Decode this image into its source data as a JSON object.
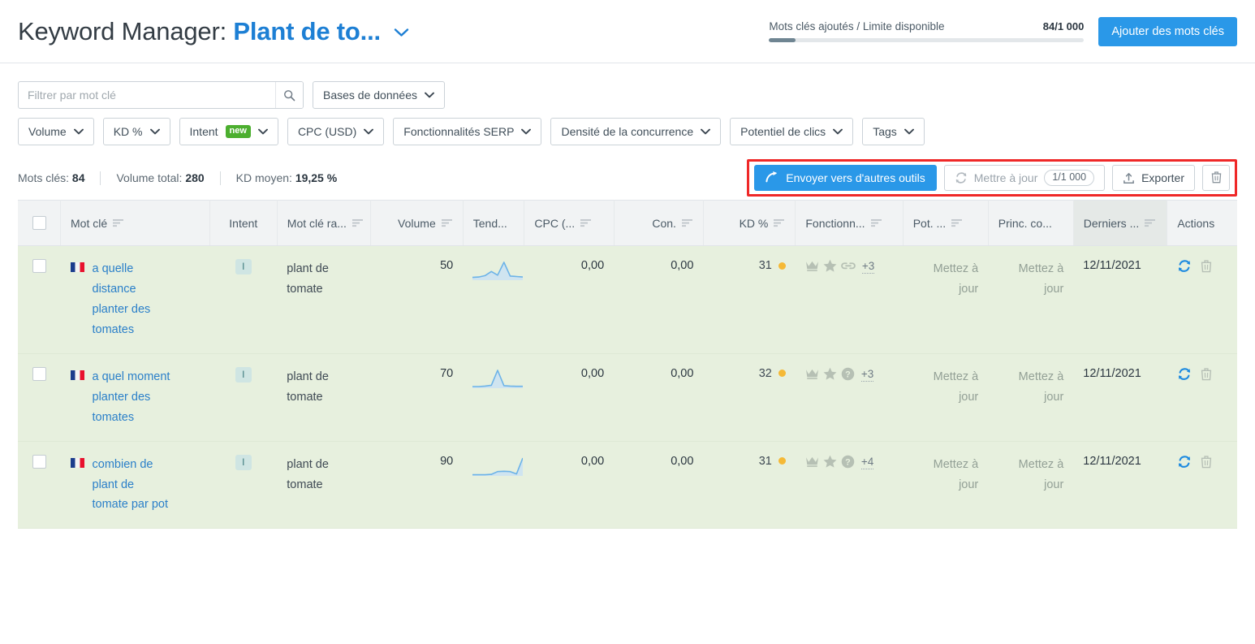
{
  "header": {
    "title_prefix": "Keyword Manager: ",
    "project_name": "Plant de to...",
    "caret": "⌄",
    "limit_label": "Mots clés ajoutés / Limite disponible",
    "limit_value": "84/1 000",
    "limit_percent": 8.4,
    "add_keywords_label": "Ajouter des mots clés"
  },
  "filters": {
    "search_placeholder": "Filtrer par mot clé",
    "search_value": "",
    "databases_label": "Bases de données",
    "pills": [
      {
        "label": "Volume"
      },
      {
        "label": "KD %"
      },
      {
        "label": "Intent",
        "badge": "new"
      },
      {
        "label": "CPC (USD)"
      },
      {
        "label": "Fonctionnalités SERP"
      },
      {
        "label": "Densité de la concurrence"
      },
      {
        "label": "Potentiel de clics"
      },
      {
        "label": "Tags"
      }
    ]
  },
  "summary": {
    "keywords_label": "Mots clés:",
    "keywords_value": "84",
    "volume_label": "Volume total:",
    "volume_value": "280",
    "kd_label": "KD moyen:",
    "kd_value": "19,25 %"
  },
  "actions": {
    "send_label": "Envoyer vers d'autres outils",
    "update_label": "Mettre à jour",
    "update_count": "1/1 000",
    "export_label": "Exporter",
    "delete_icon": "trash-icon",
    "highlight_color": "#ef2828"
  },
  "table": {
    "columns": [
      {
        "label": "",
        "name": "select-all",
        "sortable": false,
        "align": "center"
      },
      {
        "label": "Mot clé",
        "name": "keyword",
        "sortable": true,
        "align": "left"
      },
      {
        "label": "Intent",
        "name": "intent",
        "sortable": false,
        "align": "center"
      },
      {
        "label": "Mot clé ra...",
        "name": "keyword-ratio",
        "sortable": true,
        "align": "left"
      },
      {
        "label": "Volume",
        "name": "volume",
        "sortable": true,
        "align": "right"
      },
      {
        "label": "Tend...",
        "name": "trend",
        "sortable": false,
        "align": "left"
      },
      {
        "label": "CPC (...",
        "name": "cpc",
        "sortable": true,
        "align": "left"
      },
      {
        "label": "Con.",
        "name": "competition",
        "sortable": true,
        "align": "right"
      },
      {
        "label": "KD %",
        "name": "keyword-difficulty",
        "sortable": true,
        "align": "right"
      },
      {
        "label": "Fonctionn...",
        "name": "serp-features",
        "sortable": true,
        "align": "left"
      },
      {
        "label": "Pot. ...",
        "name": "click-potential",
        "sortable": true,
        "align": "left"
      },
      {
        "label": "Princ. co...",
        "name": "main-competitor",
        "sortable": false,
        "align": "left"
      },
      {
        "label": "Derniers ...",
        "name": "last-update",
        "sortable": true,
        "align": "left",
        "sorted": true
      },
      {
        "label": "Actions",
        "name": "actions",
        "sortable": false,
        "align": "left"
      }
    ],
    "rows": [
      {
        "checked": false,
        "flag": "fr",
        "keyword": "a quelle distance planter des tomates",
        "intent": "I",
        "keyword_ratio": "plant de tomate",
        "volume": "50",
        "trend": [
          12,
          14,
          20,
          38,
          22,
          78,
          18,
          16,
          14
        ],
        "cpc": "0,00",
        "competition": "0,00",
        "kd": "31",
        "kd_color": "#f5b936",
        "serp_features": [
          "crown-icon",
          "star-icon",
          "link-icon"
        ],
        "serp_more": "+3",
        "click_potential": "Mettez à jour",
        "main_competitor": "Mettez à jour",
        "last_update": "12/11/2021",
        "actions": [
          "refresh-icon",
          "trash-icon"
        ]
      },
      {
        "checked": false,
        "flag": "fr",
        "keyword": "a quel moment planter des tomates",
        "intent": "I",
        "keyword_ratio": "plant de tomate",
        "volume": "70",
        "trend": [
          8,
          8,
          10,
          14,
          86,
          12,
          10,
          9,
          9
        ],
        "cpc": "0,00",
        "competition": "0,00",
        "kd": "32",
        "kd_color": "#f5b936",
        "serp_features": [
          "crown-icon",
          "star-icon",
          "question-icon"
        ],
        "serp_more": "+3",
        "click_potential": "Mettez à jour",
        "main_competitor": "Mettez à jour",
        "last_update": "12/11/2021",
        "actions": [
          "refresh-icon",
          "trash-icon"
        ]
      },
      {
        "checked": false,
        "flag": "fr",
        "keyword": "combien de plant de tomate par pot",
        "intent": "I",
        "keyword_ratio": "plant de tomate",
        "volume": "90",
        "trend": [
          6,
          6,
          6,
          8,
          22,
          24,
          22,
          10,
          92
        ],
        "cpc": "0,00",
        "competition": "0,00",
        "kd": "31",
        "kd_color": "#f5b936",
        "serp_features": [
          "crown-icon",
          "star-icon",
          "question-icon"
        ],
        "serp_more": "+4",
        "click_potential": "Mettez à jour",
        "main_competitor": "Mettez à jour",
        "last_update": "12/11/2021",
        "actions": [
          "refresh-icon",
          "trash-icon"
        ]
      }
    ]
  }
}
